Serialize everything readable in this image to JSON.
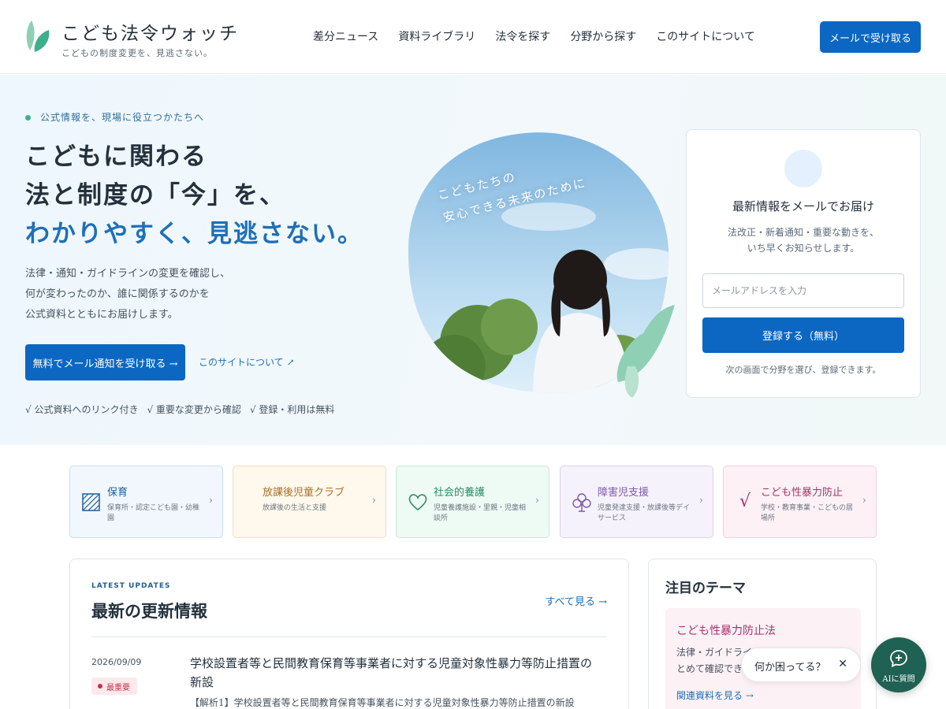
{
  "header": {
    "logo_title": "こども法令ウォッチ",
    "logo_subtitle": "こどもの制度変更を、見逃さない。",
    "nav": [
      "差分ニュース",
      "資料ライブラリ",
      "法令を探す",
      "分野から探す",
      "このサイトについて"
    ],
    "cta": "メールで受け取る"
  },
  "hero": {
    "eyebrow": "公式情報を、現場に役立つかたちへ",
    "heading_line1": "こどもに関わる",
    "heading_line2": "法と制度の「今」を、",
    "heading_line3": "わかりやすく、見逃さない。",
    "paragraph_line1": "法律・通知・ガイドラインの変更を確認し、",
    "paragraph_line2": "何が変わったのか、誰に関係するのかを",
    "paragraph_line3": "公式資料とともにお届けします。",
    "primary_button": "無料でメール通知を受け取る →",
    "secondary_link": "このサイトについて ↗",
    "checks": [
      "√ 公式資料へのリンク付き",
      "√ 重要な変更から確認",
      "√ 登録・利用は無料"
    ],
    "image_text_line1": "こどもたちの",
    "image_text_line2": "安心できる未来のために"
  },
  "signup": {
    "title": "最新情報をメールでお届け",
    "desc_line1": "法改正・新着通知・重要な動きを、",
    "desc_line2": "いち早くお知らせします。",
    "email_placeholder": "メールアドレスを入力",
    "button": "登録する（無料）",
    "note": "次の画面で分野を選び、登録できます。"
  },
  "categories": [
    {
      "title": "保育",
      "subtitle": "保育所・認定こども園・幼稚園",
      "icon": "hatched-square-icon",
      "color": "#1f5f98",
      "bg": "#f1f7fd",
      "border": "#c9dff0"
    },
    {
      "title": "放課後児童クラブ",
      "subtitle": "放課後の生活と支援",
      "icon": "",
      "color": "#a7702b",
      "bg": "#fff8ec",
      "border": "#f1dfbd"
    },
    {
      "title": "社会的養護",
      "subtitle": "児童養護施設・里親・児童相談所",
      "icon": "heart-icon",
      "color": "#2f8a69",
      "bg": "#eefaf4",
      "border": "#c7e9d9"
    },
    {
      "title": "障害児支援",
      "subtitle": "児童発達支援・放課後等デイサービス",
      "icon": "clover-icon",
      "color": "#7d5aa8",
      "bg": "#f6f2fc",
      "border": "#ddd1ee"
    },
    {
      "title": "こども性暴力防止",
      "subtitle": "学校・教育事業・こどもの居場所",
      "icon": "check-icon",
      "color": "#a8336b",
      "bg": "#fdf1f6",
      "border": "#f1cfdf"
    }
  ],
  "latest": {
    "eyebrow": "LATEST UPDATES",
    "title": "最新の更新情報",
    "view_all": "すべて見る →",
    "items": [
      {
        "date": "2026/09/09",
        "badge": "最重要",
        "headline": "学校設置者等と民間教育保育等事業者に対する児童対象性暴力等防止措置の新設",
        "summary": "【解析1】学校設置者等と民間教育保育等事業者に対する児童対象性暴力等防止措置の新設"
      }
    ]
  },
  "featured": {
    "title": "注目のテーマ",
    "card_title": "こども性暴力防止法",
    "card_desc_line1": "法律・ガイドライン",
    "card_desc_line2": "とめて確認でき",
    "card_link": "関連資料を見る →"
  },
  "chat": {
    "bubble_text": "何か困ってる？",
    "close": "✕",
    "button_label": "AIに質問"
  },
  "colors": {
    "primary": "#0b67c2",
    "accent_green": "#3fae8c",
    "chat_green": "#1f6152",
    "urgent": "#c2334a"
  }
}
